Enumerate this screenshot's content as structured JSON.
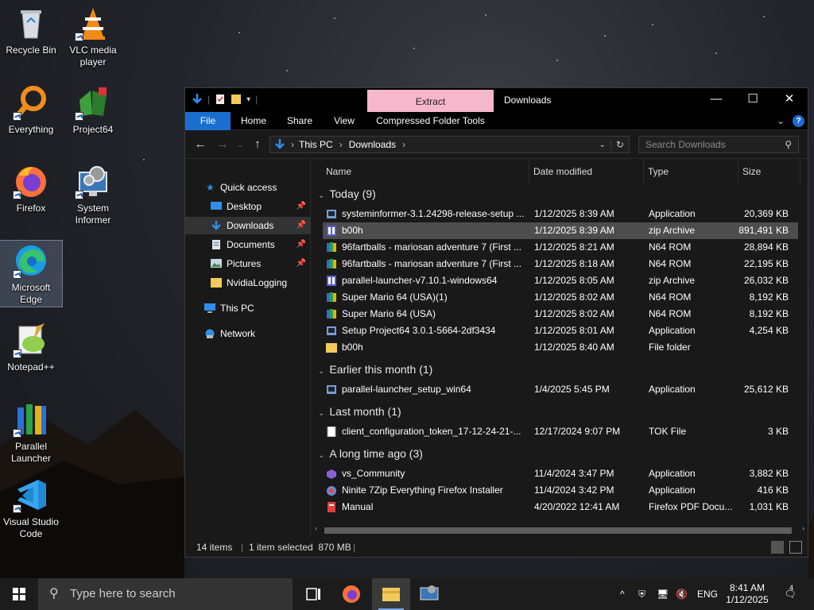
{
  "desktop": {
    "icons": [
      {
        "label": "Recycle Bin"
      },
      {
        "label": "VLC media player"
      },
      {
        "label": "Everything"
      },
      {
        "label": "Project64"
      },
      {
        "label": "Firefox"
      },
      {
        "label": "System Informer"
      },
      {
        "label": "Microsoft Edge"
      },
      {
        "label": "Notepad++"
      },
      {
        "label": "Parallel Launcher"
      },
      {
        "label": "Visual Studio Code"
      }
    ]
  },
  "window": {
    "title": "Downloads",
    "contextual_tab": "Extract",
    "controls": {
      "minimize": "—",
      "maximize": "☐",
      "close": "✕"
    },
    "ribbon_tabs": [
      "File",
      "Home",
      "Share",
      "View",
      "Compressed Folder Tools"
    ],
    "address": {
      "crumbs": [
        "This PC",
        "Downloads"
      ],
      "separator": "›"
    },
    "search_placeholder": "Search Downloads",
    "nav": {
      "quick_access": "Quick access",
      "items": [
        "Desktop",
        "Downloads",
        "Documents",
        "Pictures",
        "NvidiaLogging"
      ],
      "this_pc": "This PC",
      "network": "Network"
    },
    "columns": [
      "Name",
      "Date modified",
      "Type",
      "Size"
    ],
    "groups": [
      {
        "title": "Today (9)",
        "rows": [
          {
            "name": "systeminformer-3.1.24298-release-setup ...",
            "date": "1/12/2025 8:39 AM",
            "type": "Application",
            "size": "20,369 KB",
            "icon": "installer-icon"
          },
          {
            "name": "b00h",
            "date": "1/12/2025 8:39 AM",
            "type": "zip Archive",
            "size": "891,491 KB",
            "icon": "zip-icon",
            "selected": true
          },
          {
            "name": "96fartballs - mariosan adventure 7 (First ...",
            "date": "1/12/2025 8:21 AM",
            "type": "N64 ROM",
            "size": "28,894 KB",
            "icon": "rom-icon"
          },
          {
            "name": "96fartballs - mariosan adventure 7 (First ...",
            "date": "1/12/2025 8:18 AM",
            "type": "N64 ROM",
            "size": "22,195 KB",
            "icon": "rom-icon"
          },
          {
            "name": "parallel-launcher-v7.10.1-windows64",
            "date": "1/12/2025 8:05 AM",
            "type": "zip Archive",
            "size": "26,032 KB",
            "icon": "zip-icon"
          },
          {
            "name": "Super Mario 64 (USA)(1)",
            "date": "1/12/2025 8:02 AM",
            "type": "N64 ROM",
            "size": "8,192 KB",
            "icon": "rom-icon"
          },
          {
            "name": "Super Mario 64 (USA)",
            "date": "1/12/2025 8:02 AM",
            "type": "N64 ROM",
            "size": "8,192 KB",
            "icon": "rom-icon"
          },
          {
            "name": "Setup Project64 3.0.1-5664-2df3434",
            "date": "1/12/2025 8:01 AM",
            "type": "Application",
            "size": "4,254 KB",
            "icon": "installer-icon"
          },
          {
            "name": "b00h",
            "date": "1/12/2025 8:40 AM",
            "type": "File folder",
            "size": "",
            "icon": "folder-icon"
          }
        ]
      },
      {
        "title": "Earlier this month (1)",
        "rows": [
          {
            "name": "parallel-launcher_setup_win64",
            "date": "1/4/2025 5:45 PM",
            "type": "Application",
            "size": "25,612 KB",
            "icon": "installer-icon"
          }
        ]
      },
      {
        "title": "Last month (1)",
        "rows": [
          {
            "name": "client_configuration_token_17-12-24-21-...",
            "date": "12/17/2024 9:07 PM",
            "type": "TOK File",
            "size": "3 KB",
            "icon": "document-icon"
          }
        ]
      },
      {
        "title": "A long time ago (3)",
        "rows": [
          {
            "name": "vs_Community",
            "date": "11/4/2024 3:47 PM",
            "type": "Application",
            "size": "3,882 KB",
            "icon": "vs-icon"
          },
          {
            "name": "Ninite 7Zip Everything Firefox Installer",
            "date": "11/4/2024 3:42 PM",
            "type": "Application",
            "size": "416 KB",
            "icon": "ninite-icon"
          },
          {
            "name": "Manual",
            "date": "4/20/2022 12:41 AM",
            "type": "Firefox PDF Docu...",
            "size": "1,031 KB",
            "icon": "pdf-icon"
          }
        ]
      }
    ],
    "status": {
      "items": "14 items",
      "selected": "1 item selected  870 MB"
    }
  },
  "taskbar": {
    "search_placeholder": "Type here to search",
    "language": "ENG",
    "time": "8:41 AM",
    "date": "1/12/2025",
    "notifications": "4"
  },
  "colors": {
    "accent": "#1a6ed0",
    "extract_tab": "#f6b6cc",
    "selected_row": "#4d4d4d"
  }
}
